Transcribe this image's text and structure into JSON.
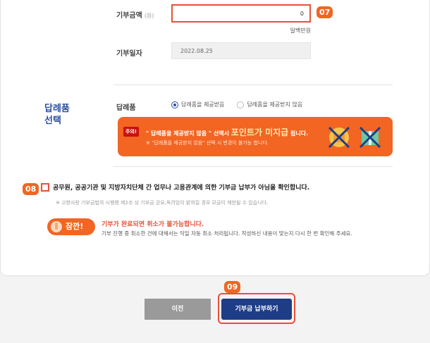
{
  "amount": {
    "label": "기부금액",
    "unit": "(원)",
    "value": "0",
    "badge": "07",
    "hint": "일백만원"
  },
  "date": {
    "label": "기부일자",
    "value": "2022.08.25"
  },
  "gift": {
    "section_title_1": "답례품",
    "section_title_2": "선택",
    "label": "답례품",
    "option_receive": "답례품을 제공받음",
    "option_decline": "답례품을 제공받지 않음",
    "notice_tag": "주의!",
    "notice_line1_pre": "\" 답례품을 제공받지 않음 \" 선택시",
    "notice_line1_bold": "포인트가 미지급",
    "notice_line1_post": "됩니다.",
    "notice_line2": "※ \"답례품을 제공받지 않음\" 선택 시 변경이 불가능 합니다."
  },
  "confirm": {
    "badge": "08",
    "text": "공무원, 공공기관 및 지방자치단체 간 업무나 고용관계에 의한 기부금 납부가 아님을 확인합니다.",
    "sub": "※ 고향사랑 기부금법의 시행령 제2조 상 기부금 강요,독려임이 밝혀질 경우 모금이 제한될 수 있습니다."
  },
  "warning": {
    "pill": "잠깐!",
    "title": "기부가 완료되면 취소가 불가능합니다.",
    "sub": "기부 진행 중 취소한 건에 대해서는 익일 자동 취소 처리됩니다. 작성하신 내용이 맞는지 다시 한 번 확인해 주세요."
  },
  "buttons": {
    "prev": "이전",
    "submit": "기부금 납부하기",
    "submit_badge": "09"
  },
  "colors": {
    "accent": "#f26522",
    "highlight": "#e8503a",
    "navy": "#1e3d86",
    "blue_text": "#2a4fa0"
  }
}
